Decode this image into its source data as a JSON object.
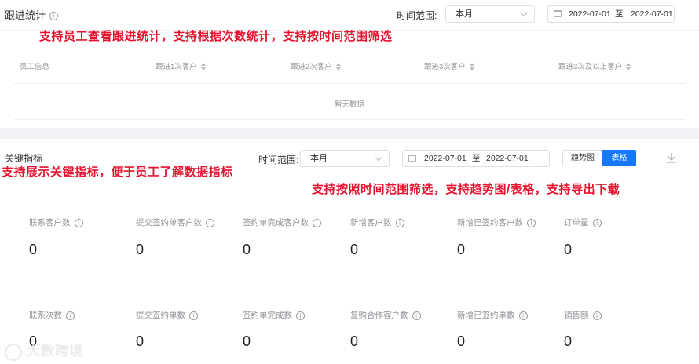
{
  "followup": {
    "title": "跟进统计",
    "time_range_label": "时间范围:",
    "time_range_value": "本月",
    "date_start": "2022-07-01",
    "date_sep": "至",
    "date_end": "2022-07-01",
    "annotation": "支持员工查看跟进统计，支持根据次数统计，支持按时间范围筛选",
    "columns": [
      "员工信息",
      "跟进1次客户",
      "跟进2次客户",
      "跟进3次客户",
      "跟进3次及以上客户"
    ],
    "empty_text": "暂无数据"
  },
  "key_metrics": {
    "title": "关键指标",
    "annotation_left": "支持展示关键指标，便于员工了解数据指标",
    "annotation_right": "支持按照时间范围筛选，支持趋势图/表格，支持导出下载",
    "time_range_label": "时间范围:",
    "time_range_value": "本月",
    "date_start": "2022-07-01",
    "date_sep": "至",
    "date_end": "2022-07-01",
    "view_trend": "趋势图",
    "view_table": "表格",
    "row1": [
      {
        "label": "联系客户数",
        "value": "0"
      },
      {
        "label": "提交签约单客户数",
        "value": "0"
      },
      {
        "label": "签约单完成客户数",
        "value": "0"
      },
      {
        "label": "新增客户数",
        "value": "0"
      },
      {
        "label": "新增已签约客户数",
        "value": "0"
      },
      {
        "label": "订单量",
        "value": "0"
      }
    ],
    "row2": [
      {
        "label": "联系次数",
        "value": "0"
      },
      {
        "label": "提交签约单数",
        "value": "0"
      },
      {
        "label": "签约单完成数",
        "value": "0"
      },
      {
        "label": "复购合作客户数",
        "value": "0"
      },
      {
        "label": "新增已签约单数",
        "value": "0"
      },
      {
        "label": "销售额",
        "value": "0"
      }
    ]
  },
  "watermark": "大数跨境",
  "colors": {
    "accent": "#1677ff",
    "annotation_red": "#e8112d"
  }
}
